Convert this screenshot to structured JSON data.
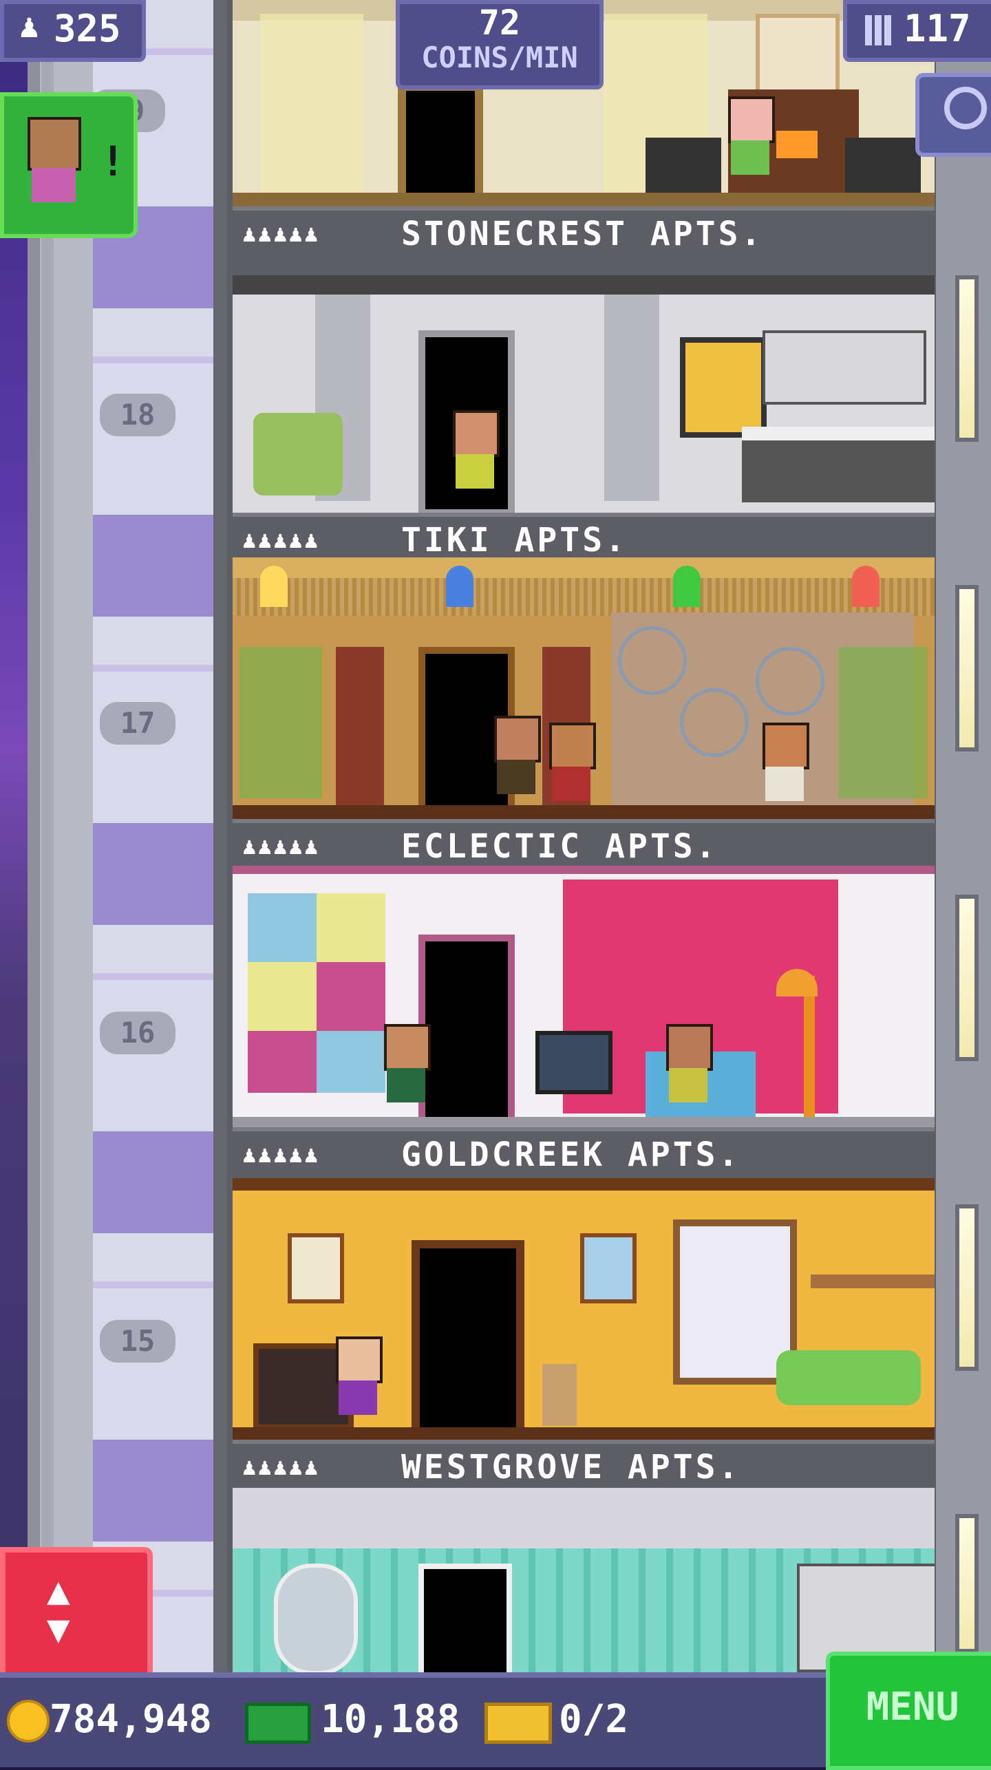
{
  "hud": {
    "population": "325",
    "coins_per_min_value": "72",
    "coins_per_min_unit": "COINS/MIN",
    "floors_count": "117"
  },
  "icons": {
    "population": "person-icon",
    "floors": "building-icon",
    "magnify": "magnifier-icon",
    "elevator": "up-down-arrows-icon",
    "coin": "coin-icon",
    "bux": "bux-bill-icon",
    "ticket": "golden-ticket-icon",
    "notification": "visitor-alert-icon"
  },
  "floors": [
    {
      "number": "19",
      "name": "STONECREST APTS.",
      "people": "♟♟♟♟♟",
      "wall": "#e9e2c5"
    },
    {
      "number": "18",
      "name": "TIKI APTS.",
      "people": "♟♟♟♟♟",
      "wall": "#dcdce0"
    },
    {
      "number": "17",
      "name": "ECLECTIC APTS.",
      "people": "♟♟♟♟♟",
      "wall": "#b57a2a"
    },
    {
      "number": "16",
      "name": "GOLDCREEK APTS.",
      "people": "♟♟♟♟♟",
      "wall": "#f2f0f2"
    },
    {
      "number": "15",
      "name": "WESTGROVE APTS.",
      "people": "♟♟♟♟♟",
      "wall": "#f0b840"
    },
    {
      "number": "14",
      "name": "",
      "people": "",
      "wall": "#7ed8c8"
    }
  ],
  "bottom": {
    "coins": "784,948",
    "bux": "10,188",
    "tickets": "0/2",
    "menu_label": "MENU"
  },
  "notification_mark": "!",
  "colors": {
    "menu_green": "#22c43a",
    "elevator_red": "#e8304a",
    "hud_purple": "#4f4d8a"
  }
}
